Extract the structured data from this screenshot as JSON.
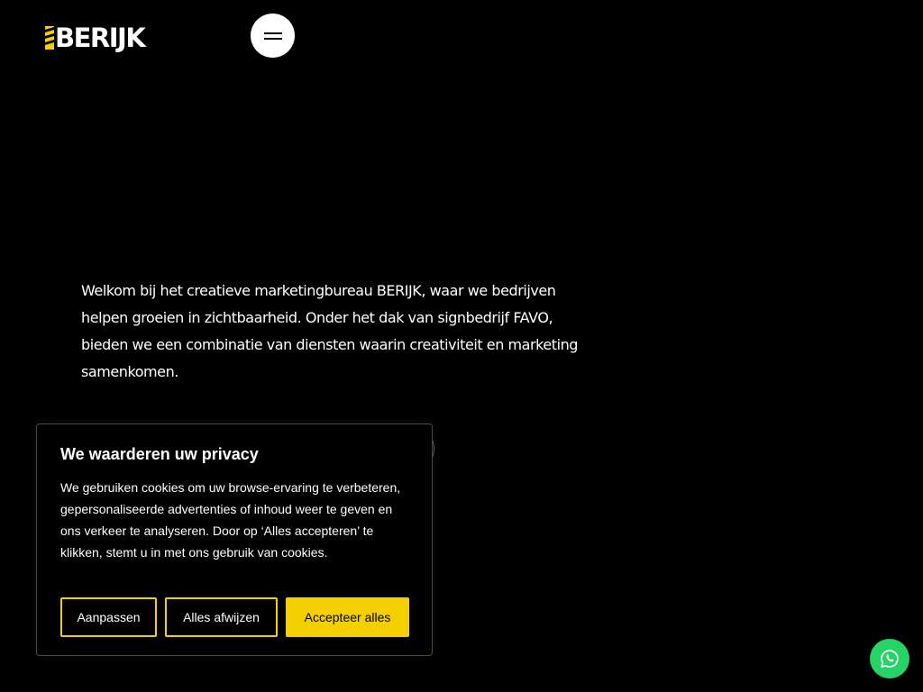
{
  "header": {
    "logo_text": "BERIJK",
    "logo_accent": "#f5d000",
    "menu_icon": "hamburger-icon"
  },
  "main": {
    "intro": "Welkom bij het creatieve marketingbureau BERIJK, waar we bedrijven helpen groeien in zichtbaarheid. Onder het dak van signbedrijf FAVO, bieden we een combinatie van diensten waarin creativiteit en marketing samenkomen."
  },
  "cookie_banner": {
    "title": "We waarderen uw privacy",
    "text": "We gebruiken cookies om uw browse-ervaring te verbeteren, gepersonaliseerde advertenties of inhoud weer te geven en ons verkeer te analyseren. Door op ‘Alles accepteren’ te klikken, stemt u in met ons gebruik van cookies.",
    "customize_label": "Aanpassen",
    "reject_label": "Alles afwijzen",
    "accept_label": "Accepteer alles",
    "accent_color": "#f5d000"
  },
  "floating": {
    "whatsapp_icon": "whatsapp-icon",
    "whatsapp_color": "#25d366"
  }
}
